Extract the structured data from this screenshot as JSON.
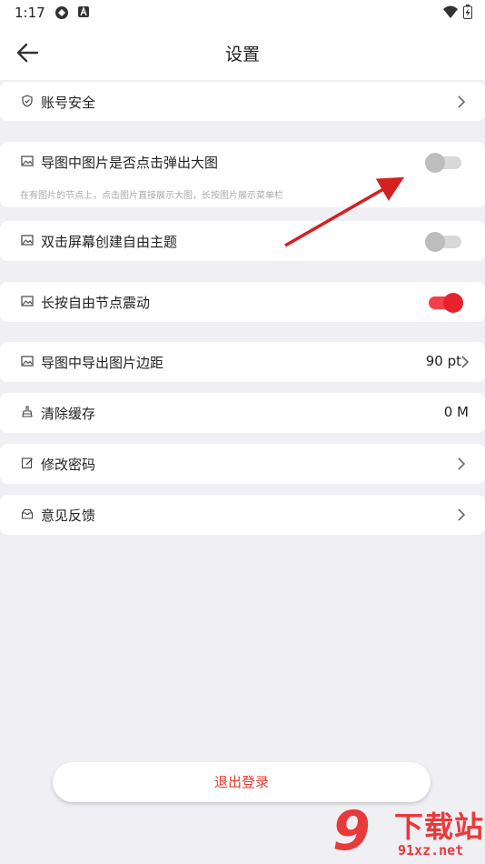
{
  "status_bar": {
    "time": "1:17",
    "icons": [
      "sync-icon",
      "accessibility-icon",
      "wifi-icon",
      "battery-charging-icon"
    ]
  },
  "header": {
    "title": "设置",
    "back_icon": "back-arrow-icon"
  },
  "settings": {
    "account_security": {
      "label": "账号安全",
      "icon": "shield-icon"
    },
    "image_popup": {
      "label": "导图中图片是否点击弹出大图",
      "hint": "在有图片的节点上，点击图片直接展示大图，长按图片展示菜单栏",
      "icon": "image-icon",
      "enabled": false
    },
    "double_tap": {
      "label": "双击屏幕创建自由主题",
      "icon": "image-icon",
      "enabled": false
    },
    "long_press_vibrate": {
      "label": "长按自由节点震动",
      "icon": "image-icon",
      "enabled": true
    },
    "export_margin": {
      "label": "导图中导出图片边距",
      "value": "90 pt",
      "icon": "image-icon"
    },
    "clear_cache": {
      "label": "清除缓存",
      "value": "0 M",
      "icon": "broom-icon"
    },
    "change_password": {
      "label": "修改密码",
      "icon": "edit-icon"
    },
    "feedback": {
      "label": "意见反馈",
      "icon": "feedback-icon"
    }
  },
  "logout": {
    "label": "退出登录"
  },
  "watermark": {
    "main": "下载站",
    "sub": "91xz.net",
    "logo": "9"
  },
  "colors": {
    "accent": "#e8222d",
    "logout_text": "#e33a2f",
    "background": "#efeff4"
  }
}
